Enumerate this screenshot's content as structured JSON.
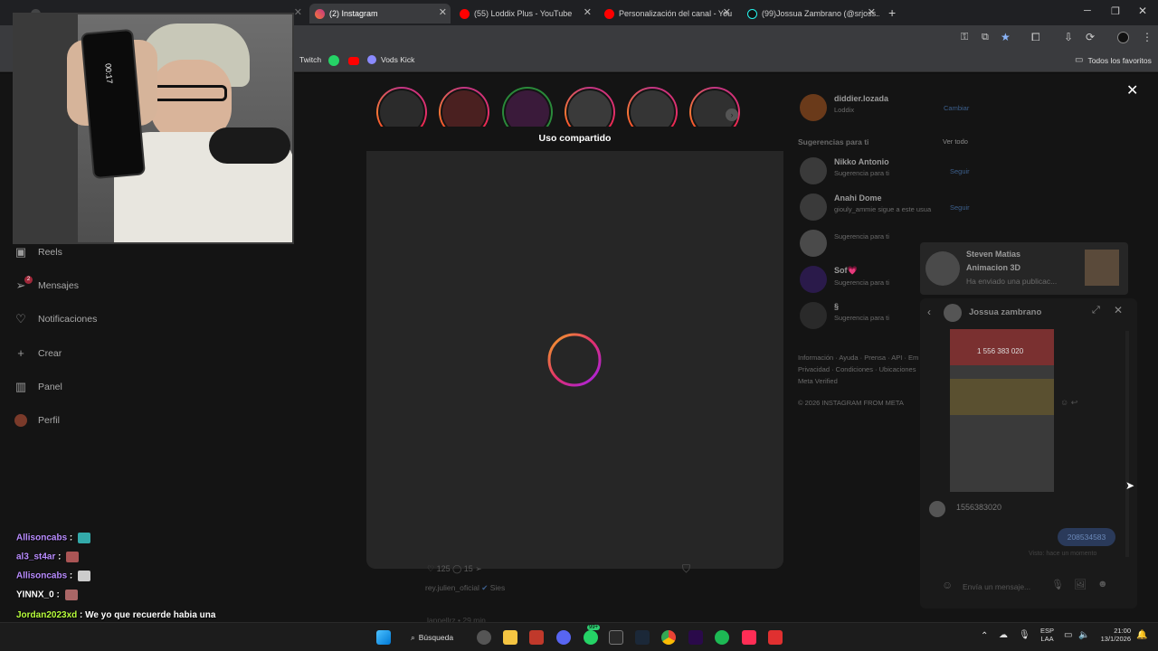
{
  "tabs": [
    {
      "label": "(2) Instagram",
      "active": true
    },
    {
      "label": "(55) Loddix Plus - YouTube"
    },
    {
      "label": "Personalización del canal - You"
    },
    {
      "label": "(99)Jossua Zambrano (@srjoss..."
    }
  ],
  "bookmarks": {
    "twitch": "Twitch",
    "vods": "Vods Kick",
    "favorites": "Todos los favoritos"
  },
  "sidebar": {
    "items": [
      "Reels",
      "Mensajes",
      "Notificaciones",
      "Crear",
      "Panel",
      "Perfil"
    ],
    "messages_badge": "2"
  },
  "modal": {
    "title": "Uso compartido"
  },
  "feed": {
    "likes": "125",
    "comments": "15",
    "username": "rey.julien_oficial",
    "following": "Sies",
    "next_user": "lappellrz",
    "next_time": "29 min"
  },
  "account": {
    "username": "diddier.lozada",
    "name": "Loddix",
    "switch": "Cambiar"
  },
  "suggestions": {
    "title": "Sugerencias para ti",
    "see_all": "Ver todo",
    "follow": "Seguir",
    "items": [
      {
        "name": "Nikko Antonio",
        "sub": "Sugerencia para ti"
      },
      {
        "name": "Anahi Dome",
        "sub": "giouly_ammie sigue a este usua"
      },
      {
        "name": "",
        "sub": "Sugerencia para ti"
      },
      {
        "name": "Sof💗",
        "sub": "Sugerencia para ti"
      },
      {
        "name": "§",
        "sub": "Sugerencia para ti"
      }
    ]
  },
  "footer": {
    "links1": "Información · Ayuda · Prensa · API · Em",
    "links2": "Privacidad · Condiciones · Ubicaciones",
    "links3": "Meta Verified",
    "copyright": "© 2026 INSTAGRAM FROM META"
  },
  "notification": {
    "name": "Steven Matias",
    "name2": "Animacion 3D",
    "text": "Ha enviado una publicac..."
  },
  "chat": {
    "contact": "Jossua zambrano",
    "image_text": "1 556 383 020",
    "received": "1556383020",
    "sent": "208534583",
    "seen": "Visto: hace un momento",
    "placeholder": "Envía un mensaje..."
  },
  "twitch_chat": [
    {
      "user": "Allisoncabs",
      "msg": ""
    },
    {
      "user": "al3_st4ar",
      "msg": ""
    },
    {
      "user": "Allisoncabs",
      "msg": ""
    },
    {
      "user": "YINNX_0",
      "msg": ""
    },
    {
      "user": "Jordan2023xd",
      "msg": "We yo que recuerde habia una tienda xd (soy og) 😵 😵"
    }
  ],
  "taskbar": {
    "search": "Búsqueda",
    "lang1": "ESP",
    "lang2": "LAA",
    "time": "21:00",
    "date": "13/1/2026",
    "discord_badge": "99+"
  },
  "webcam": {
    "phone_time": "00:17"
  }
}
